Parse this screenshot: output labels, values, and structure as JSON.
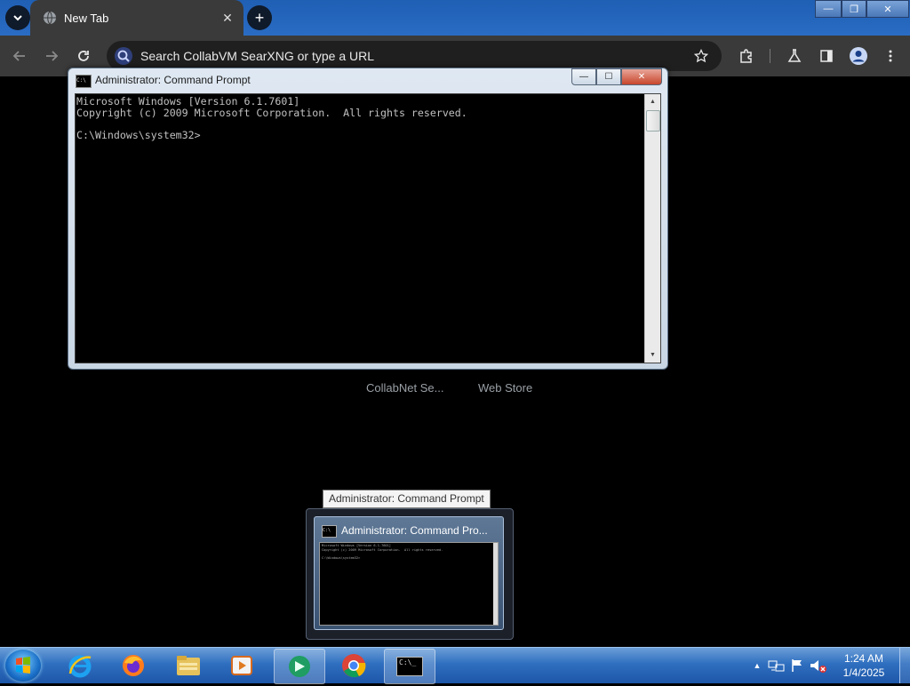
{
  "browser": {
    "tab": {
      "title": "New Tab",
      "favicon": "globe-icon"
    },
    "omnibox": {
      "placeholder": "Search CollabVM SearXNG or type a URL",
      "value": ""
    },
    "toolbar_icons": [
      "back-icon",
      "forward-icon",
      "reload-icon",
      "extensions-icon",
      "labs-icon",
      "side-panel-icon",
      "profile-icon",
      "menu-icon"
    ],
    "shortcuts": [
      {
        "label": "CollabNet Se..."
      },
      {
        "label": "Web Store"
      }
    ],
    "window_controls": {
      "minimize": "—",
      "restore": "❐",
      "close": "✕"
    }
  },
  "cmd_window": {
    "title": "Administrator:  Command Prompt",
    "icon_text": "C:\\",
    "controls": {
      "minimize": "—",
      "maximize": "☐",
      "close": "✕"
    },
    "console_lines": [
      "Microsoft Windows [Version 6.1.7601]",
      "Copyright (c) 2009 Microsoft Corporation.  All rights reserved.",
      "",
      "C:\\Windows\\system32>"
    ]
  },
  "taskbar_preview": {
    "tooltip": "Administrator:  Command Prompt",
    "title": "Administrator:  Command Pro...",
    "preview_lines": [
      "Microsoft Windows [Version 6.1.7601]",
      "Copyright (c) 2009 Microsoft Corporation.  All rights reserved.",
      "",
      "C:\\Windows\\system32>"
    ]
  },
  "taskbar": {
    "apps": [
      "internet-explorer-icon",
      "firefox-icon",
      "file-explorer-icon",
      "media-player-icon",
      "green-app-icon",
      "chrome-icon",
      "command-prompt-icon"
    ],
    "tray_icons": [
      "show-hidden-icons",
      "network-icon",
      "action-center-flag-icon",
      "volume-muted-icon"
    ],
    "clock": {
      "time": "1:24 AM",
      "date": "1/4/2025"
    }
  },
  "colors": {
    "titlebar_blue": "#2a6cc4",
    "chrome_dark": "#3a3a3a",
    "console_text": "#c0c0c0",
    "taskbar_blue": "#2f6fc0"
  }
}
